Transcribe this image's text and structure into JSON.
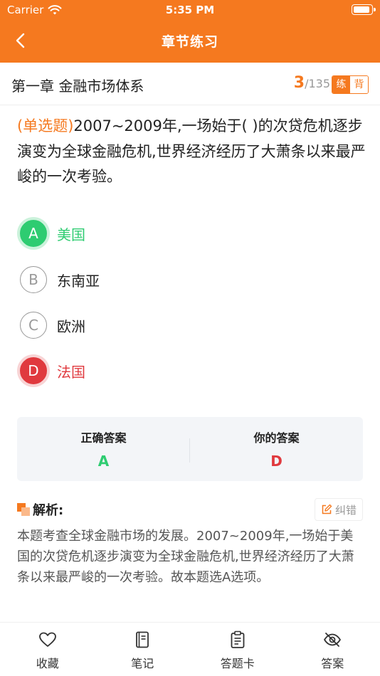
{
  "status_bar": {
    "carrier": "Carrier",
    "time": "5:35 PM"
  },
  "nav": {
    "title": "章节练习"
  },
  "chapter": {
    "title": "第一章 金融市场体系",
    "current": "3",
    "separator": "/",
    "total": "135",
    "mode_practice": "练",
    "mode_recite": "背"
  },
  "question": {
    "type_label": "(单选题)",
    "text": "2007~2009年,一场始于( )的次贷危机逐步演变为全球金融危机,世界经济经历了大萧条以来最严峻的一次考验。"
  },
  "options": [
    {
      "letter": "A",
      "text": "美国",
      "state": "correct"
    },
    {
      "letter": "B",
      "text": "东南亚",
      "state": "normal"
    },
    {
      "letter": "C",
      "text": "欧洲",
      "state": "normal"
    },
    {
      "letter": "D",
      "text": "法国",
      "state": "wrong"
    }
  ],
  "answers": {
    "correct_label": "正确答案",
    "correct_value": "A",
    "yours_label": "你的答案",
    "yours_value": "D"
  },
  "analysis": {
    "title": "解析:",
    "report_label": "纠错",
    "text": "本题考查全球金融市场的发展。2007~2009年,一场始于美国的次贷危机逐步演变为全球金融危机,世界经济经历了大萧条以来最严峻的一次考验。故本题选A选项。"
  },
  "tabs": [
    {
      "label": "收藏",
      "icon": "heart-icon"
    },
    {
      "label": "笔记",
      "icon": "notebook-icon"
    },
    {
      "label": "答题卡",
      "icon": "clipboard-icon"
    },
    {
      "label": "答案",
      "icon": "eye-off-icon"
    }
  ],
  "colors": {
    "brand": "#F5791F",
    "correct": "#2ECC71",
    "wrong": "#E0393E"
  }
}
